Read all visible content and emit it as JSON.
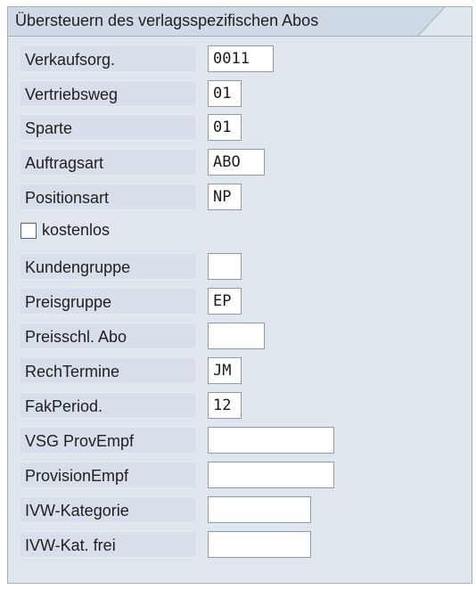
{
  "panel": {
    "title": "Übersteuern des verlagsspezifischen Abos"
  },
  "fields": [
    {
      "label": "Verkaufsorg.",
      "value": "0011"
    },
    {
      "label": "Vertriebsweg",
      "value": "01"
    },
    {
      "label": "Sparte",
      "value": "01"
    },
    {
      "label": "Auftragsart",
      "value": "ABO"
    },
    {
      "label": "Positionsart",
      "value": "NP"
    },
    {
      "label": "Kundengruppe",
      "value": ""
    },
    {
      "label": "Preisgruppe",
      "value": "EP"
    },
    {
      "label": "Preisschl. Abo",
      "value": ""
    },
    {
      "label": "RechTermine",
      "value": "JM"
    },
    {
      "label": "FakPeriod.",
      "value": "12"
    },
    {
      "label": "VSG ProvEmpf",
      "value": ""
    },
    {
      "label": "ProvisionEmpf",
      "value": ""
    },
    {
      "label": "IVW-Kategorie",
      "value": ""
    },
    {
      "label": "IVW-Kat. frei",
      "value": ""
    }
  ],
  "checkbox": {
    "label": "kostenlos",
    "checked": false
  }
}
